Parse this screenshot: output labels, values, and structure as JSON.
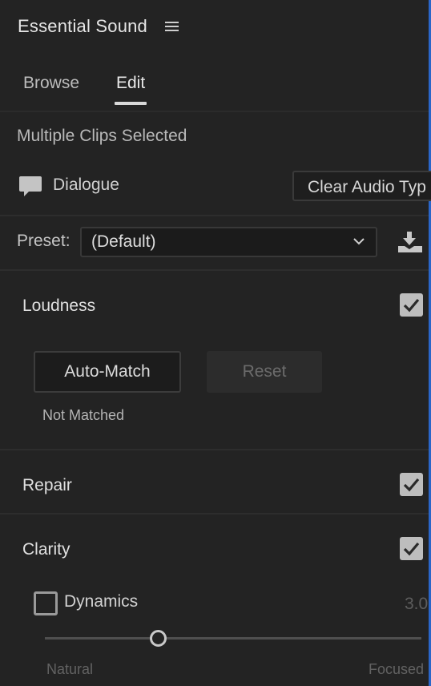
{
  "panel": {
    "title": "Essential Sound",
    "tabs": [
      {
        "label": "Browse",
        "active": false
      },
      {
        "label": "Edit",
        "active": true
      }
    ],
    "selection_label": "Multiple Clips Selected"
  },
  "audio_type": {
    "label": "Dialogue",
    "icon": "speech-bubble-icon",
    "clear_button": "Clear Audio Typ"
  },
  "preset": {
    "label": "Preset:",
    "value": "(Default)",
    "save_icon": "save-preset-icon"
  },
  "loudness": {
    "title": "Loudness",
    "enabled": true,
    "auto_match_button": "Auto-Match",
    "reset_button": "Reset",
    "status": "Not Matched"
  },
  "repair": {
    "title": "Repair",
    "enabled": true
  },
  "clarity": {
    "title": "Clarity",
    "enabled": true,
    "dynamics": {
      "label": "Dynamics",
      "enabled": false,
      "value": "3.0",
      "slider_fraction": 0.3,
      "left_label": "Natural",
      "right_label": "Focused"
    }
  },
  "colors": {
    "background": "#232323",
    "accent_edge": "#2a66c8",
    "text": "#d6d6d6"
  }
}
